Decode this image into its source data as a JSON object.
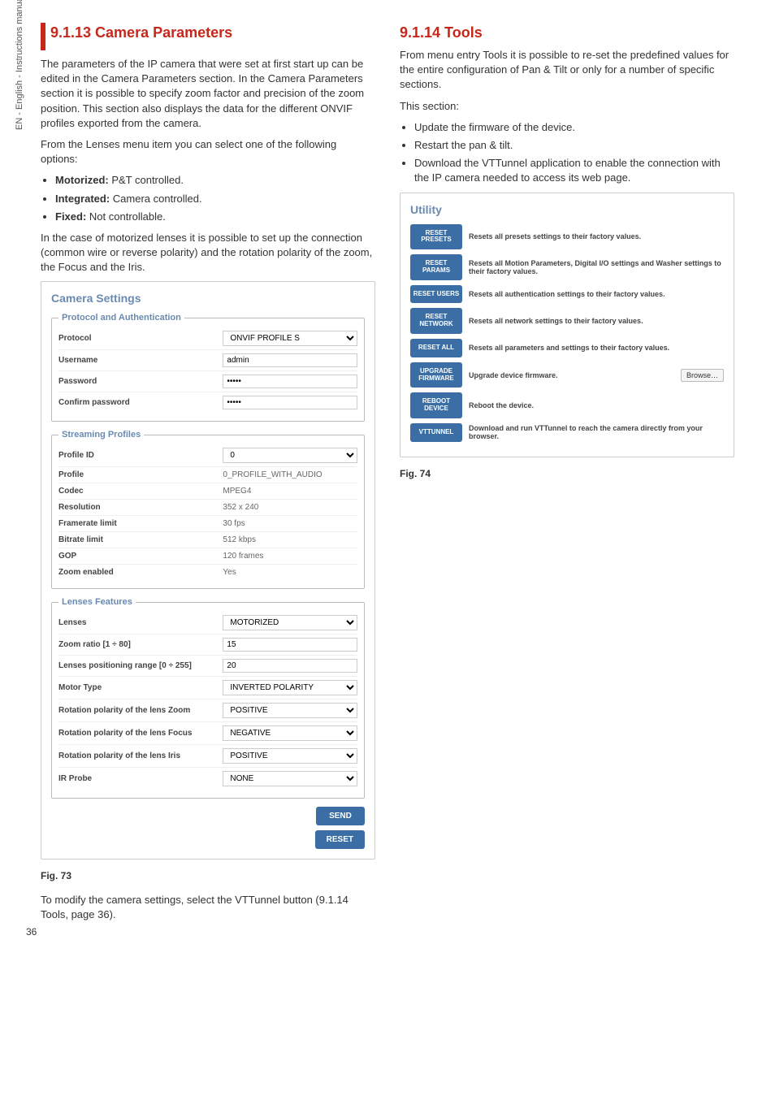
{
  "sideText": "EN - English - Instructions manual",
  "pageNumber": "36",
  "left": {
    "heading": "9.1.13 Camera Parameters",
    "para1": "The parameters of the IP camera that were set at first start up can be edited in the Camera Parameters section. In the Camera Parameters section it is possible to specify zoom factor and precision of the zoom position. This section also displays the data for the different ONVIF profiles exported from the camera.",
    "para2": "From the Lenses menu item you can select one of the following options:",
    "b1": {
      "label": "Motorized:",
      "text": " P&T controlled."
    },
    "b2": {
      "label": "Integrated:",
      "text": " Camera controlled."
    },
    "b3": {
      "label": "Fixed:",
      "text": " Not controllable."
    },
    "para3": "In the case of motorized lenses it is possible to  set up the connection (common wire or reverse polarity) and the rotation polarity of the zoom, the Focus and the Iris.",
    "boxTitle": "Camera Settings",
    "fs1": {
      "legend": "Protocol and Authentication",
      "rows": {
        "protocol": {
          "label": "Protocol",
          "value": "ONVIF PROFILE S"
        },
        "username": {
          "label": "Username",
          "value": "admin"
        },
        "password": {
          "label": "Password",
          "value": "•••••"
        },
        "confirm": {
          "label": "Confirm password",
          "value": "•••••"
        }
      }
    },
    "fs2": {
      "legend": "Streaming Profiles",
      "rows": {
        "pid": {
          "label": "Profile ID",
          "value": "0"
        },
        "prof": {
          "label": "Profile",
          "value": "0_PROFILE_WITH_AUDIO"
        },
        "codec": {
          "label": "Codec",
          "value": "MPEG4"
        },
        "res": {
          "label": "Resolution",
          "value": "352 x 240"
        },
        "fps": {
          "label": "Framerate limit",
          "value": "30 fps"
        },
        "bit": {
          "label": "Bitrate limit",
          "value": "512 kbps"
        },
        "gop": {
          "label": "GOP",
          "value": "120 frames"
        },
        "zoom": {
          "label": "Zoom enabled",
          "value": "Yes"
        }
      }
    },
    "fs3": {
      "legend": "Lenses Features",
      "rows": {
        "lenses": {
          "label": "Lenses",
          "value": "MOTORIZED"
        },
        "zratio": {
          "label": "Zoom ratio [1 ÷ 80]",
          "value": "15"
        },
        "lrange": {
          "label": "Lenses positioning range [0 ÷ 255]",
          "value": "20"
        },
        "mtype": {
          "label": "Motor Type",
          "value": "INVERTED POLARITY"
        },
        "rzoom": {
          "label": "Rotation polarity of the lens Zoom",
          "value": "POSITIVE"
        },
        "rfocus": {
          "label": "Rotation polarity of the lens Focus",
          "value": "NEGATIVE"
        },
        "riris": {
          "label": "Rotation polarity of the lens Iris",
          "value": "POSITIVE"
        },
        "irprobe": {
          "label": "IR Probe",
          "value": "NONE"
        }
      }
    },
    "sendBtn": "SEND",
    "resetBtn": "RESET",
    "figCaption": "Fig. 73",
    "para4": "To modify the camera settings, select the VTTunnel button (9.1.14 Tools, page 36)."
  },
  "right": {
    "heading": "9.1.14 Tools",
    "para1": "From menu entry Tools  it is possible to re-set the predefined values for the entire configuration of Pan & Tilt or only for a number of specific sections.",
    "para2": "This section:",
    "b1": "Update the firmware of the device.",
    "b2": "Restart the pan & tilt.",
    "b3": "Download the VTTunnel application to enable the connection with the IP camera needed to access its web page.",
    "boxTitle": "Utility",
    "rows": {
      "presets": {
        "btn": "RESET PRESETS",
        "text": "Resets all presets settings to their factory values."
      },
      "params": {
        "btn": "RESET PARAMS",
        "text": "Resets all Motion Parameters, Digital I/O settings and Washer settings to their factory values."
      },
      "users": {
        "btn": "RESET USERS",
        "text": "Resets all authentication settings to their factory values."
      },
      "network": {
        "btn": "RESET NETWORK",
        "text": "Resets all network settings to their factory values."
      },
      "all": {
        "btn": "RESET ALL",
        "text": "Resets all parameters and settings to their factory values."
      },
      "upgrade": {
        "btn": "UPGRADE FIRMWARE",
        "text": "Upgrade device firmware.",
        "browse": "Browse…"
      },
      "reboot": {
        "btn": "REBOOT DEVICE",
        "text": "Reboot the device."
      },
      "vttunnel": {
        "btn": "VTTUNNEL",
        "text": "Download and run VTTunnel to reach the camera directly from your browser."
      }
    },
    "figCaption": "Fig. 74"
  }
}
